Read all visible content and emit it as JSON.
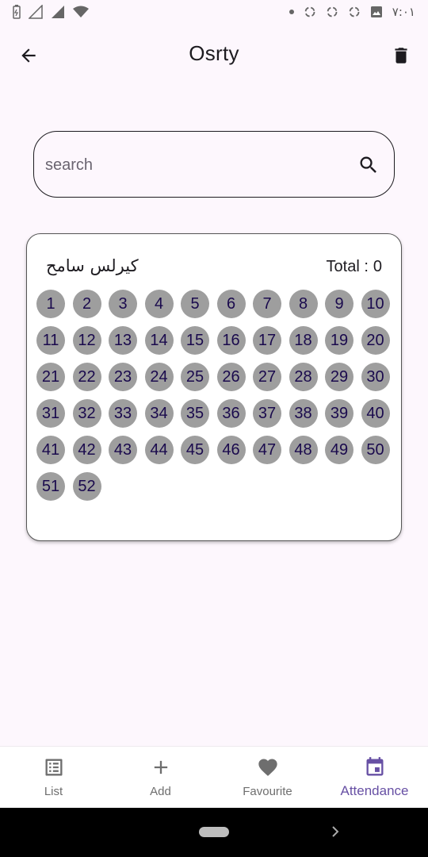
{
  "status_bar": {
    "time": "٧:٠١",
    "left_icons": [
      "battery-icon",
      "signal-empty-icon",
      "signal-full-icon",
      "wifi-icon"
    ],
    "right_icons": [
      "dot-icon",
      "sync-icon",
      "sync-icon",
      "sync-icon",
      "image-icon"
    ]
  },
  "app_bar": {
    "title": "Osrty",
    "back_icon": "arrow-left-icon",
    "delete_icon": "trash-icon"
  },
  "search": {
    "placeholder": "search",
    "value": "",
    "icon": "search-icon"
  },
  "card": {
    "name": "كيرلس سامح",
    "total_label": "Total :",
    "total_value": "0",
    "numbers": [
      "1",
      "2",
      "3",
      "4",
      "5",
      "6",
      "7",
      "8",
      "9",
      "10",
      "11",
      "12",
      "13",
      "14",
      "15",
      "16",
      "17",
      "18",
      "19",
      "20",
      "21",
      "22",
      "23",
      "24",
      "25",
      "26",
      "27",
      "28",
      "29",
      "30",
      "31",
      "32",
      "33",
      "34",
      "35",
      "36",
      "37",
      "38",
      "39",
      "40",
      "41",
      "42",
      "43",
      "44",
      "45",
      "46",
      "47",
      "48",
      "49",
      "50",
      "51",
      "52"
    ]
  },
  "bottom_nav": {
    "items": [
      {
        "label": "List",
        "icon": "list-icon",
        "active": false
      },
      {
        "label": "Add",
        "icon": "plus-icon",
        "active": false
      },
      {
        "label": "Favourite",
        "icon": "heart-icon",
        "active": false
      },
      {
        "label": "Attendance",
        "icon": "calendar-icon",
        "active": true
      }
    ]
  },
  "colors": {
    "background": "#fdf7fd",
    "number_circle": "#9e9e9e",
    "number_text": "#1a0a4d",
    "active_nav": "#6750a4",
    "inactive_nav": "#6e6e6e"
  }
}
